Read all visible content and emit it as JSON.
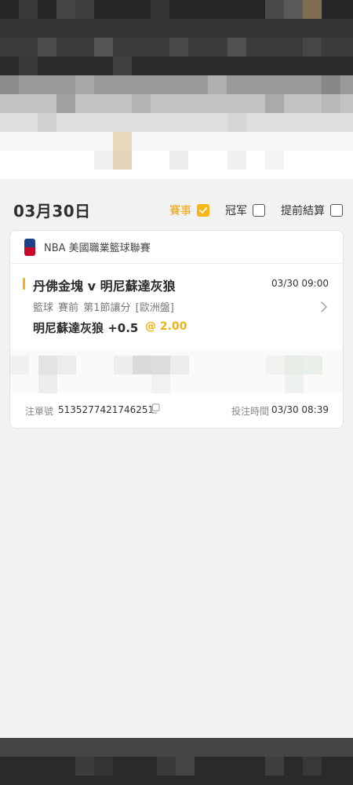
{
  "header": {
    "date": "03月30日",
    "filters": [
      {
        "label": "賽事",
        "checked": true
      },
      {
        "label": "冠军",
        "checked": false
      },
      {
        "label": "提前結算",
        "checked": false
      }
    ]
  },
  "card": {
    "league": {
      "icon": "nba-logo-icon",
      "name": "NBA 美國職業籃球聯賽"
    },
    "match": {
      "title": "丹佛金塊 v 明尼蘇達灰狼",
      "time": "03/30 09:00",
      "description": "籃球  賽前  第1節讓分 [歐洲盤]",
      "selection": "明尼蘇達灰狼 +0.5",
      "odds": "@ 2.00"
    },
    "footer": {
      "order_label": "注單號",
      "order_no": "5135277421746251",
      "bet_time_label": "投注時間",
      "bet_time": "03/30 08:39"
    }
  },
  "colors": {
    "accent": "#f5b40f",
    "background": "#f2f2f2",
    "card": "#ffffff"
  }
}
